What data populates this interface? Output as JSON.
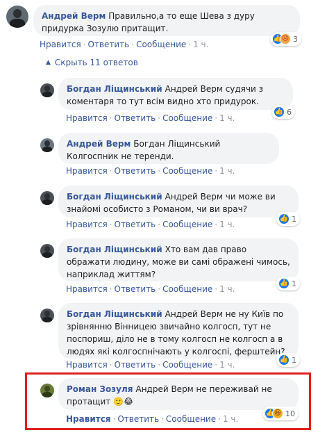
{
  "comments": [
    {
      "author": "Андрей Верм",
      "text": "Правильно,а то еще Шева з дуру придурка Зозулю притащит.",
      "actions": {
        "like": "Нравится",
        "reply": "Ответить",
        "message": "Сообщение",
        "time": "1 ч."
      },
      "reactions": {
        "icons": [
          "like-icon",
          "angry-icon"
        ],
        "count": "3"
      }
    },
    {
      "author": "Богдан Ліщинський",
      "text": "Андрей Верм судячи з коментаря то тут всім видно хто придурок.",
      "actions": {
        "like": "Нравится",
        "reply": "Ответить",
        "message": "Сообщение",
        "time": "1 ч."
      },
      "reactions": {
        "icons": [
          "like-icon"
        ],
        "count": "6"
      }
    },
    {
      "author": "Андрей Верм",
      "text": "Богдан Ліщинський Колгоспник не теренди.",
      "actions": {
        "like": "Нравится",
        "reply": "Ответить",
        "message": "Сообщение",
        "time": "1 ч."
      }
    },
    {
      "author": "Богдан Ліщинський",
      "text": "Андрей Верм чи може ви знайомі особисто з Романом, чи ви врач?",
      "actions": {
        "like": "Нравится",
        "reply": "Ответить",
        "message": "Сообщение",
        "time": "1 ч."
      },
      "reactions": {
        "icons": [
          "like-icon"
        ],
        "count": "1"
      }
    },
    {
      "author": "Богдан Ліщинський",
      "text": "Хто вам дав право ображати людину, може ви самі ображені чимось, наприклад життям?",
      "actions": {
        "like": "Нравится",
        "reply": "Ответить",
        "message": "Сообщение",
        "time": "1 ч."
      },
      "reactions": {
        "icons": [
          "like-icon"
        ],
        "count": "1"
      }
    },
    {
      "author": "Богдан Ліщинський",
      "text": "Андрей Верм не ну Київ по зрівнянню Вінницею звичайно колгосп, тут не поспориш, діло не в тому колгосп не колгосп а в людях які колгоспнічають у колгоспі, ферштейн?",
      "actions": {
        "like": "Нравится",
        "reply": "Ответить",
        "message": "Сообщение",
        "time": "1 ч."
      },
      "reactions": {
        "icons": [
          "like-icon"
        ],
        "count": "1"
      }
    },
    {
      "author": "Роман Зозуля",
      "text": "Андрей Верм не переживай не протащит 🙂😂",
      "actions": {
        "like": "Нравится",
        "reply": "Ответить",
        "message": "Сообщение",
        "time": "1 ч."
      },
      "reactions": {
        "icons": [
          "like-icon",
          "haha-icon"
        ],
        "count": "10"
      }
    }
  ],
  "hide_replies": {
    "label": "Скрыть 11 ответов",
    "icon": "chevron-up-icon"
  },
  "colors": {
    "link": "#385898",
    "bubble": "#f2f3f5",
    "meta": "#90949c",
    "like": "#1877f2",
    "highlight": "#e02020"
  }
}
